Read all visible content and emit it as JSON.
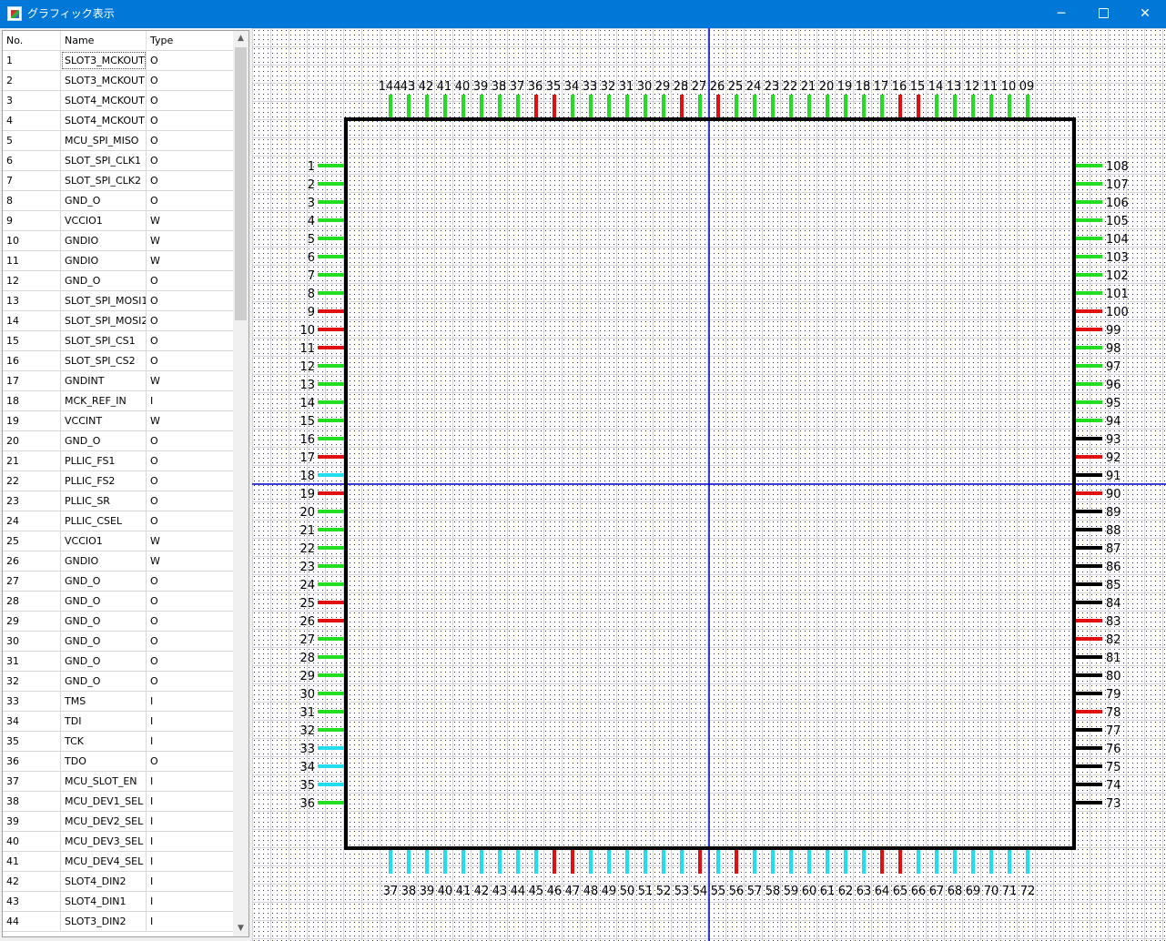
{
  "window": {
    "title": "グラフィック表示",
    "min_glyph": "─",
    "close_glyph": "✕",
    "icon": "app-graphic-icon"
  },
  "pin_table": {
    "columns": [
      "No.",
      "Name",
      "Type"
    ],
    "rows": [
      [
        "1",
        "SLOT3_MCKOUT",
        "O"
      ],
      [
        "2",
        "SLOT3_MCKOUT",
        "O"
      ],
      [
        "3",
        "SLOT4_MCKOUT",
        "O"
      ],
      [
        "4",
        "SLOT4_MCKOUT",
        "O"
      ],
      [
        "5",
        "MCU_SPI_MISO",
        "O"
      ],
      [
        "6",
        "SLOT_SPI_CLK1",
        "O"
      ],
      [
        "7",
        "SLOT_SPI_CLK2",
        "O"
      ],
      [
        "8",
        "GND_O",
        "O"
      ],
      [
        "9",
        "VCCIO1",
        "W"
      ],
      [
        "10",
        "GNDIO",
        "W"
      ],
      [
        "11",
        "GNDIO",
        "W"
      ],
      [
        "12",
        "GND_O",
        "O"
      ],
      [
        "13",
        "SLOT_SPI_MOSI1",
        "O"
      ],
      [
        "14",
        "SLOT_SPI_MOSI2",
        "O"
      ],
      [
        "15",
        "SLOT_SPI_CS1",
        "O"
      ],
      [
        "16",
        "SLOT_SPI_CS2",
        "O"
      ],
      [
        "17",
        "GNDINT",
        "W"
      ],
      [
        "18",
        "MCK_REF_IN",
        "I"
      ],
      [
        "19",
        "VCCINT",
        "W"
      ],
      [
        "20",
        "GND_O",
        "O"
      ],
      [
        "21",
        "PLLIC_FS1",
        "O"
      ],
      [
        "22",
        "PLLIC_FS2",
        "O"
      ],
      [
        "23",
        "PLLIC_SR",
        "O"
      ],
      [
        "24",
        "PLLIC_CSEL",
        "O"
      ],
      [
        "25",
        "VCCIO1",
        "W"
      ],
      [
        "26",
        "GNDIO",
        "W"
      ],
      [
        "27",
        "GND_O",
        "O"
      ],
      [
        "28",
        "GND_O",
        "O"
      ],
      [
        "29",
        "GND_O",
        "O"
      ],
      [
        "30",
        "GND_O",
        "O"
      ],
      [
        "31",
        "GND_O",
        "O"
      ],
      [
        "32",
        "GND_O",
        "O"
      ],
      [
        "33",
        "TMS",
        "I"
      ],
      [
        "34",
        "TDI",
        "I"
      ],
      [
        "35",
        "TCK",
        "I"
      ],
      [
        "36",
        "TDO",
        "O"
      ],
      [
        "37",
        "MCU_SLOT_EN",
        "I"
      ],
      [
        "38",
        "MCU_DEV1_SEL",
        "I"
      ],
      [
        "39",
        "MCU_DEV2_SEL",
        "I"
      ],
      [
        "40",
        "MCU_DEV3_SEL",
        "I"
      ],
      [
        "41",
        "MCU_DEV4_SEL",
        "I"
      ],
      [
        "42",
        "SLOT4_DIN2",
        "I"
      ],
      [
        "43",
        "SLOT4_DIN1",
        "I"
      ],
      [
        "44",
        "SLOT3_DIN2",
        "I"
      ]
    ],
    "scroll_up_glyph": "▲",
    "scroll_down_glyph": "▼"
  },
  "package_view": {
    "colors": {
      "output": "#22dd22",
      "power": "#e01010",
      "input": "#22ddee",
      "unassigned": "#000000",
      "body_outline": "#000000",
      "crosshair": "#0000cc",
      "grid_dots": "#2a2a6a"
    },
    "top_labels": [
      "144",
      "43",
      "42",
      "41",
      "40",
      "39",
      "38",
      "37",
      "36",
      "35",
      "34",
      "33",
      "32",
      "31",
      "30",
      "29",
      "28",
      "27",
      "26",
      "25",
      "24",
      "23",
      "22",
      "21",
      "20",
      "19",
      "18",
      "17",
      "16",
      "15",
      "14",
      "13",
      "12",
      "11",
      "10",
      "09"
    ],
    "top_colors": [
      "green",
      "green",
      "green",
      "green",
      "green",
      "green",
      "green",
      "green",
      "red",
      "red",
      "green",
      "green",
      "green",
      "green",
      "green",
      "green",
      "red",
      "green",
      "red",
      "green",
      "green",
      "green",
      "green",
      "green",
      "green",
      "green",
      "green",
      "green",
      "red",
      "red",
      "green",
      "green",
      "green",
      "green",
      "green",
      "green"
    ],
    "left_labels": [
      "1",
      "2",
      "3",
      "4",
      "5",
      "6",
      "7",
      "8",
      "9",
      "10",
      "11",
      "12",
      "13",
      "14",
      "15",
      "16",
      "17",
      "18",
      "19",
      "20",
      "21",
      "22",
      "23",
      "24",
      "25",
      "26",
      "27",
      "28",
      "29",
      "30",
      "31",
      "32",
      "33",
      "34",
      "35",
      "36"
    ],
    "left_colors": [
      "green",
      "green",
      "green",
      "green",
      "green",
      "green",
      "green",
      "green",
      "red",
      "red",
      "red",
      "green",
      "green",
      "green",
      "green",
      "green",
      "red",
      "cyan",
      "red",
      "green",
      "green",
      "green",
      "green",
      "green",
      "red",
      "red",
      "green",
      "green",
      "green",
      "green",
      "green",
      "green",
      "cyan",
      "cyan",
      "cyan",
      "green"
    ],
    "right_labels": [
      "108",
      "107",
      "106",
      "105",
      "104",
      "103",
      "102",
      "101",
      "100",
      "99",
      "98",
      "97",
      "96",
      "95",
      "94",
      "93",
      "92",
      "91",
      "90",
      "89",
      "88",
      "87",
      "86",
      "85",
      "84",
      "83",
      "82",
      "81",
      "80",
      "79",
      "78",
      "77",
      "76",
      "75",
      "74",
      "73"
    ],
    "right_colors": [
      "green",
      "green",
      "green",
      "green",
      "green",
      "green",
      "green",
      "green",
      "red",
      "red",
      "green",
      "green",
      "green",
      "green",
      "green",
      "black",
      "red",
      "black",
      "red",
      "black",
      "black",
      "black",
      "black",
      "black",
      "black",
      "red",
      "red",
      "black",
      "black",
      "black",
      "red",
      "black",
      "black",
      "black",
      "black",
      "black"
    ],
    "bottom_labels": [
      "37",
      "38",
      "39",
      "40",
      "41",
      "42",
      "43",
      "44",
      "45",
      "46",
      "47",
      "48",
      "49",
      "50",
      "51",
      "52",
      "53",
      "54",
      "55",
      "56",
      "57",
      "58",
      "59",
      "60",
      "61",
      "62",
      "63",
      "64",
      "65",
      "66",
      "67",
      "68",
      "69",
      "70",
      "71",
      "72"
    ],
    "bottom_colors": [
      "cyan",
      "cyan",
      "cyan",
      "cyan",
      "cyan",
      "cyan",
      "cyan",
      "cyan",
      "cyan",
      "red",
      "red",
      "cyan",
      "cyan",
      "cyan",
      "cyan",
      "cyan",
      "cyan",
      "red",
      "cyan",
      "red",
      "cyan",
      "cyan",
      "cyan",
      "cyan",
      "cyan",
      "cyan",
      "cyan",
      "red",
      "red",
      "cyan",
      "cyan",
      "cyan",
      "cyan",
      "cyan",
      "cyan",
      "cyan"
    ]
  }
}
